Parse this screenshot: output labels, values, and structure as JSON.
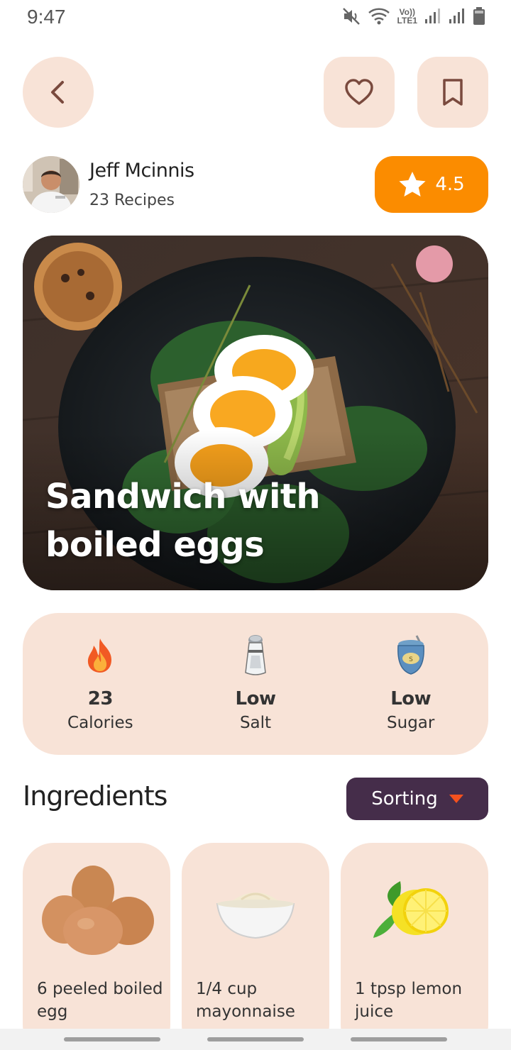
{
  "status": {
    "time": "9:47",
    "network": "LTE1"
  },
  "author": {
    "name": "Jeff Mcinnis",
    "recipes": "23 Recipes"
  },
  "rating": {
    "value": "4.5"
  },
  "recipe": {
    "title": "Sandwich with boiled eggs"
  },
  "nutrition": [
    {
      "value": "23",
      "label": "Calories",
      "icon": "fire-icon"
    },
    {
      "value": "Low",
      "label": "Salt",
      "icon": "salt-shaker-icon"
    },
    {
      "value": "Low",
      "label": "Sugar",
      "icon": "sugar-jar-icon"
    }
  ],
  "ingredients": {
    "title": "Ingredients",
    "sorting_label": "Sorting",
    "items": [
      {
        "label": "6 peeled boiled egg",
        "icon": "eggs-icon"
      },
      {
        "label": "1/4 cup mayonnaise",
        "icon": "mayonnaise-bowl-icon"
      },
      {
        "label": "1 tpsp lemon juice",
        "icon": "lemon-icon"
      }
    ]
  },
  "colors": {
    "accent": "#fb8c00",
    "card_bg": "#f8e3d7",
    "sorting_bg": "#452d4a",
    "icon_color": "#7a4a3e"
  }
}
